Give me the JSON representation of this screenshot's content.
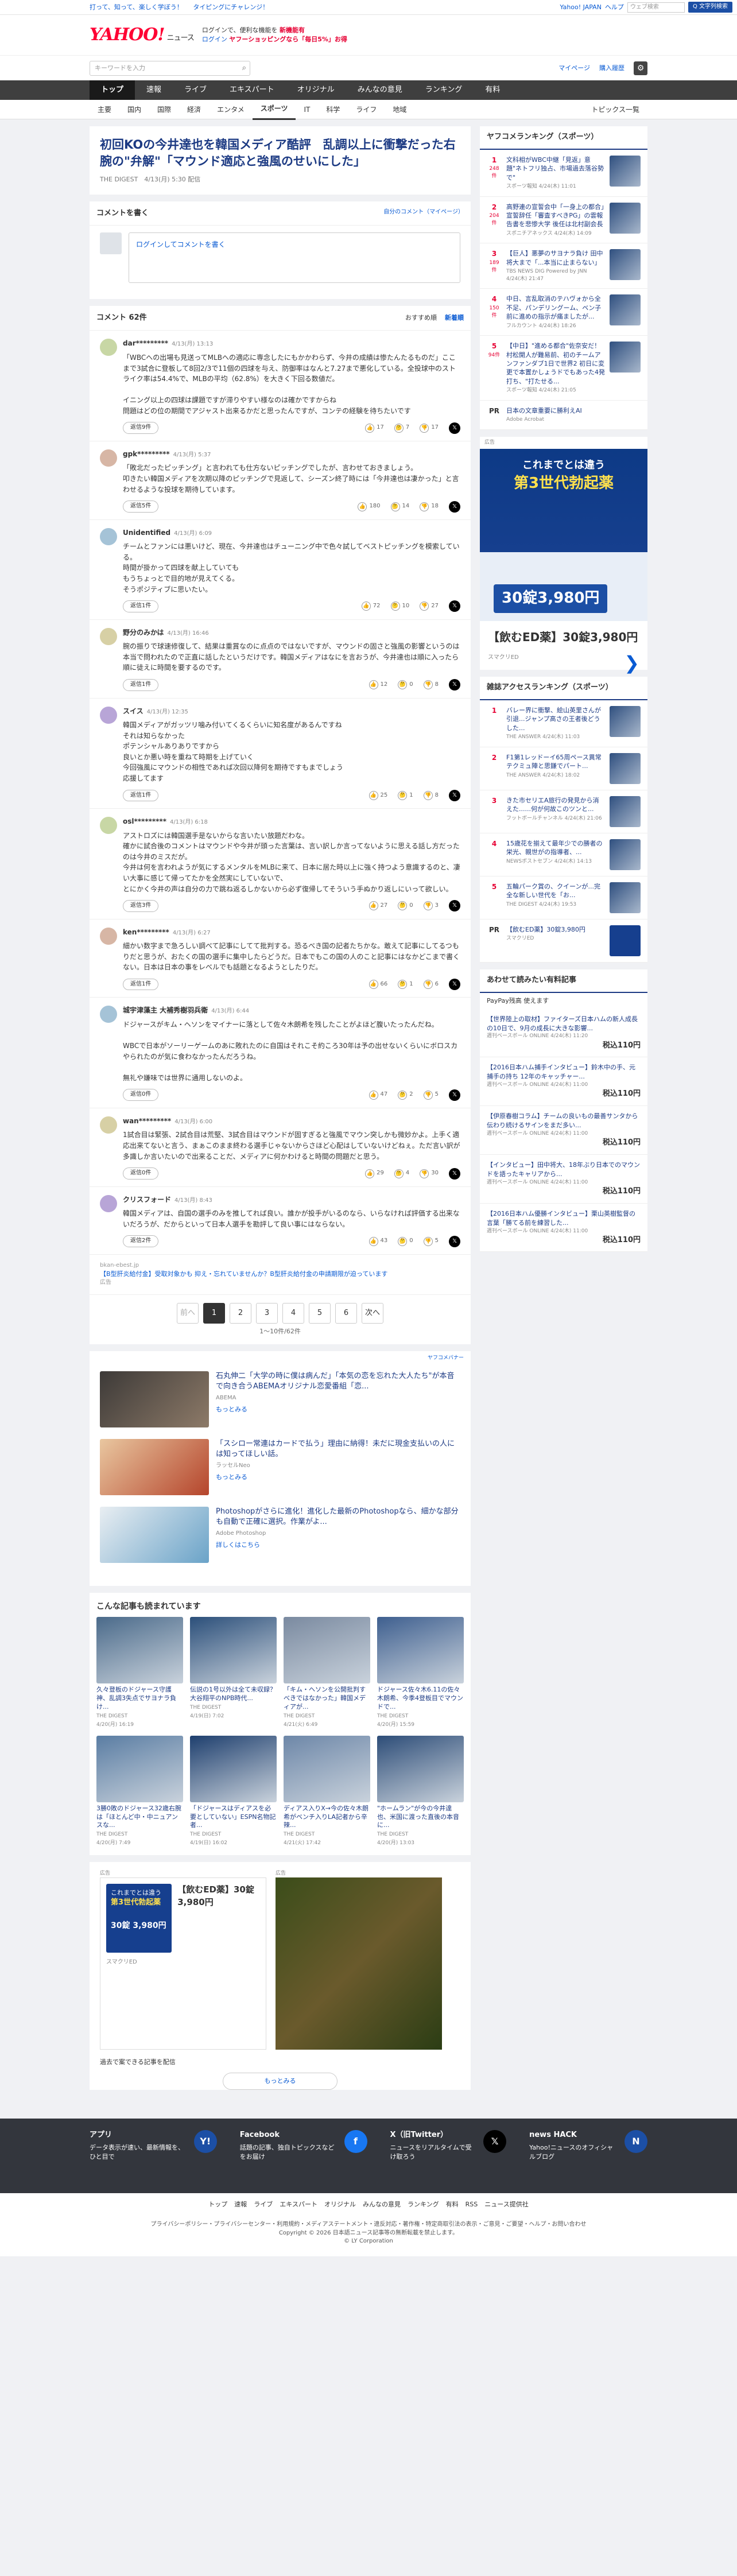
{
  "topbar": {
    "links": [
      "打って、知って、楽しく学ぼう！",
      "タイピングにチャレンジ！"
    ],
    "right": [
      "Yahoo! JAPAN",
      "ヘルプ"
    ],
    "search_placeholder": "ウェブ検索",
    "search_btn": "Q 文字列検索"
  },
  "header": {
    "logo": "YAHOO!",
    "logo_sub": "ニュース",
    "line1": "ログインで、便利な機能を",
    "line1_b": "新機能有",
    "line2": "ログイン",
    "line2_b": "ヤフーショッピングなら「毎日5%」お得"
  },
  "search": {
    "placeholder": "キーワードを入力",
    "mag": "⌕",
    "links": [
      "マイページ",
      "購入履歴"
    ],
    "gear": "⚙"
  },
  "nav1": [
    "トップ",
    "速報",
    "ライブ",
    "エキスパート",
    "オリジナル",
    "みんなの意見",
    "ランキング",
    "有料"
  ],
  "nav2": [
    "主要",
    "国内",
    "国際",
    "経済",
    "エンタメ",
    "スポーツ",
    "IT",
    "科学",
    "ライフ",
    "地域"
  ],
  "nav2_right": "トピックス一覧",
  "article": {
    "title": "初回KOの今井達也を韓国メディア酷評　乱調以上に衝撃だった右腕の\"弁解\"「マウンド適応と強風のせいにした」",
    "meta": "THE DIGEST　4/13(月) 5:30 配信"
  },
  "compose": {
    "title": "コメントを書く",
    "sub": "自分のコメント（マイページ）",
    "placeholder": "ログインしてコメントを書く"
  },
  "comments_head": {
    "title": "コメント 62件",
    "sort": [
      "おすすめ順",
      "新着順"
    ]
  },
  "comments": [
    {
      "name": "dar*********",
      "time": "4/13(月) 13:13",
      "text": "「WBCへの出場も見送ってMLBへの適応に専念したにもかかわらず、今井の成績は惨たんたるものだ」ここまで3試合に登板して8回2/3で11個の四球を与え、防御率はなんと7.27まで悪化している。全投球中のストライク率は54.4%で、MLBの平均（62.8%）を大きく下回る数値だ。\n\nイニング以上の四球は課題ですが滞りやすい様なのは確かですからね\n問題はどの位の期間でアジャスト出来るかだと思ったんですが、コンテの経験を待ちたいです",
      "rep": "返信9件",
      "v1": "17",
      "v2": "7",
      "v3": "17"
    },
    {
      "name": "gpk*********",
      "time": "4/13(月) 5:37",
      "text": "「敗北だったピッチング」と言われても仕方ないピッチングでしたが、言わせておきましょう。\n叩きたい韓国メディアを次期以降のピッチングで見返して、シーズン終了時には「今井達也は凄かった」と言わせるような投球を期待しています。",
      "rep": "返信5件",
      "v1": "180",
      "v2": "14",
      "v3": "18"
    },
    {
      "name": "Unidentified",
      "time": "4/13(月) 6:09",
      "text": "チームとファンには悪いけど、現在、今井達也はチューニング中で色々試してベストピッチングを模索している。\n時間が掛かって四球を献上していても\nもうちょっとで目的地が見えてくる。\nそうポジティブに思いたい。",
      "rep": "返信1件",
      "v1": "72",
      "v2": "10",
      "v3": "27"
    },
    {
      "name": "野分のみかは",
      "time": "4/13(月) 16:46",
      "text": "腕の振りで球速修復して、結果は重賞なのに点点のではないですが、マウンドの固さと強風の影響というのは本当で問われたので正直に話したというだけです。韓国メディアはなにを言おうが、今井達也は順に入ったら順に徒えに時間を要するのです。",
      "rep": "返信1件",
      "v1": "12",
      "v2": "0",
      "v3": "8"
    },
    {
      "name": "スイス",
      "time": "4/13(月) 12:35",
      "text": "韓国メディアがガッツリ噛み付いてくるくらいに知名度があるんですね\nそれは知らなかった\nポテンシャルありありですから\n良いとか悪い時を重ねて時期を上げていく\n今回強風にマウンドの相性であれば次回以降何を期待ですもまでしょう\n応援してます",
      "rep": "返信1件",
      "v1": "25",
      "v2": "1",
      "v3": "8"
    },
    {
      "name": "osl*********",
      "time": "4/13(月) 6:18",
      "text": "アストロズには韓国選手是ないからな言いたい放題だわな。\n確かに試合後のコメントはマウンドや今井が頭った言葉は、言い訳しか言ってないように思える話し方だったのは今井のミスだが。\n今井は何を言われようが気にするメンタルをMLBに来て、日本に居た時以上に強く持つよう意識するのと、凄い大事に感じて帰ってたかを全然実にしていないで、\nとにかく今井の声は自分の力で跳ね返るしかないから必ず復帰してそういう手ぬかり返しにいって欲しい。",
      "rep": "返信3件",
      "v1": "27",
      "v2": "0",
      "v3": "3"
    },
    {
      "name": "ken*********",
      "time": "4/13(月) 6:27",
      "text": "細かい数字まで急ろしい調べて記事にしてて批判する。恐るべき国の記者たちかな。敢えて記事にしてるつもりだと思うが、おたくの国の選手に集中したらどうだ。日本でもこの国の人のこと記事にはなかどこまで書くない。日本は日本の事をレべルでも話題となるようとしたりだ。",
      "rep": "返信1件",
      "v1": "66",
      "v2": "1",
      "v3": "6"
    },
    {
      "name": "城宇津藻主 大補秀樹羽兵衛",
      "time": "4/13(月) 6:44",
      "text": "ドジャースがキム・ヘソンをマイナーに落として佐々木朗希を残したことがよほど腹いたったんだね。\n\nWBCで日本がソーリーゲームのあに敗れたのに自国はそれこそ約ころ30年は予の出せないくらいにボロスカやられたのが気に食わなかったんだろうね。\n\n無礼や嫌味では世界に通用しないのよ。",
      "rep": "返信0件",
      "v1": "47",
      "v2": "2",
      "v3": "5"
    },
    {
      "name": "wan*********",
      "time": "4/13(月) 6:00",
      "text": "1試合目は緊張、2試合目は荒堅、3試合目はマウンドが固すぎると強風でマウン突しかも微妙かよ。上手く適応出来てないと言う、まぁこのまま終わる選手じゃないからさほど心配はしていないけどねぇ。ただ言い訳が多識しか言いたいので出来ることだ、メディアに何かわけると時間の問題だと思う。",
      "rep": "返信0件",
      "v1": "29",
      "v2": "4",
      "v3": "30"
    },
    {
      "name": "クリスフォード",
      "time": "4/13(月) 8:43",
      "text": "韓国メディアは、自国の選手のみを推してれば良い。誰かが投手がいるのなら、いらなければ評価する出来ないだろうが、だからといって日本人選手を勘評して良い事にはならない。",
      "rep": "返信2件",
      "v1": "43",
      "v2": "0",
      "v3": "5"
    }
  ],
  "inline_ad": {
    "src": "bkan-ebest.jp",
    "text": "【B型肝炎給付金】受取対象かも 抑え・忘れていませんか？B型肝炎給付金の申請期限が迫っています",
    "tag": "広告"
  },
  "pager": {
    "prev": "前へ",
    "pages": [
      "1",
      "2",
      "3",
      "4",
      "5",
      "6"
    ],
    "next": "次へ",
    "info": "1〜10件/62件"
  },
  "promo_tag": "ヤフコメバナー",
  "promos": [
    {
      "title": "石丸伸二「大学の時に僕は病んだ」「本気の恋を忘れた大人たち\"が本音で向き合うABEMAオリジナル恋愛番組「恋...",
      "src": "ABEMA",
      "more": "もっとみる"
    },
    {
      "title": "「スシロー常連はカードで払う」理由に納得！未だに現金支払いの人には知ってほしい話。",
      "src": "ラッセルNeo",
      "more": "もっとみる"
    },
    {
      "title": "Photoshopがさらに進化！進化した最新のPhotoshopなら、細かな部分も自動で正確に選択。作業がよ...",
      "src": "Adobe Photoshop",
      "more": "詳しくはこちら"
    }
  ],
  "also_title": "こんな記事も読まれています",
  "also": [
    {
      "t": "久々登板のドジャース守護神、乱調3失点でサヨナラ負け...",
      "s": "THE DIGEST",
      "d": "4/20(月) 16:19"
    },
    {
      "t": "伝説の1号以外は全て未収録？大谷翔平のNPB時代...",
      "s": "THE DIGEST",
      "d": "4/19(日) 7:02"
    },
    {
      "t": "「キム・ヘソンを公開批判すべきではなかった」韓国メディアが...",
      "s": "THE DIGEST",
      "d": "4/21(火) 6:49"
    },
    {
      "t": "ドジャース佐々木6.11の佐々木朗希、今季4登板目でマウンドで...",
      "s": "THE DIGEST",
      "d": "4/20(月) 15:59"
    },
    {
      "t": "3勝0敗のドジャース32歳右腕は「ほとんど中・中ニュアンスな...",
      "s": "THE DIGEST",
      "d": "4/20(月) 7:49"
    },
    {
      "t": "「ドジャースはディアスを必要としていない」ESPN名物記者...",
      "s": "THE DIGEST",
      "d": "4/19(日) 16:02"
    },
    {
      "t": "ディアス入りX→今の佐々木朗希がベンチ入りLA記者から辛辣...",
      "s": "THE DIGEST",
      "d": "4/21(火) 17:42"
    },
    {
      "t": "\"ホームラン\"が今の今井達也、米国に渡った直後の本音に...",
      "s": "THE DIGEST",
      "d": "4/20(月) 13:03"
    }
  ],
  "bottom_ads": {
    "tag1": "広告",
    "tag2": "広告",
    "ad1_title": "これまでとは違う",
    "ad1_b": "第3世代勃起薬",
    "ad1_price": "30錠 3,980円",
    "ad1_text": "【飲むED薬】30錠3,980円",
    "ad1_src": "スマクリED",
    "hide": "過去で案できる記事を配信",
    "more": "もっとみる"
  },
  "rank1": {
    "title": "ヤフコメランキング（スポーツ）",
    "items": [
      {
        "n": "1",
        "c": "248件",
        "t": "文科相がWBC中継「見返」意題\"ネトフリ独占、市場過去落谷勢で\"",
        "s": "スポーツ報知 4/24(木) 11:01"
      },
      {
        "n": "2",
        "c": "204件",
        "t": "高野連の宣誓会中「一身上の都合」宣誓辞任「審査すべきPG」の雲報告書を悲惨大学 後任は北村副会長",
        "s": "スポニチアネックス 4/24(木) 14:09"
      },
      {
        "n": "3",
        "c": "189件",
        "t": "【巨人】悪夢のサヨナラ負け 田中将大まで「...本当に止まらない」",
        "s": "TBS NEWS DIG Powered by JNN 4/24(木) 21:47"
      },
      {
        "n": "4",
        "c": "150件",
        "t": "中日、言乱取消のテハヴォから全不足、パンデリングーム、ベン子前に進めの指示が痛ましたが...",
        "s": "フルカウント 4/24(木) 18:26"
      },
      {
        "n": "5",
        "c": "94件",
        "t": "【中日】\"進める都合\"佐奈安だ！ 村松開人が難易前、初のチームアンファンダブ1日で世界2 初日に変更で本置かしょうドでもあった4発打ち、\"打たせる...",
        "s": "スポーツ報知 4/24(木) 21:05"
      }
    ]
  },
  "pr1": {
    "tag": "PR",
    "text": "日本の文章重要に勝利えAI",
    "src": "Adobe Acrobat"
  },
  "side_ad": {
    "tag": "広告",
    "t1": "これまでとは違う",
    "t2": "第3世代勃起薬",
    "price": "30錠3,980円",
    "text": "【飲むED薬】30錠3,980円",
    "src": "スマクリED",
    "arrow": "❯"
  },
  "rank2": {
    "title": "雑誌アクセスランキング（スポーツ）",
    "items": [
      {
        "n": "1",
        "t": "バレー界に衝撃、絵山英里さんが引退...ジャンプ高さの王者後どうした...",
        "s": "THE ANSWER 4/24(木) 11:03"
      },
      {
        "n": "2",
        "t": "F1第1レッドーイ65周ペース異常 テクミュ陣と思鎌でパート...",
        "s": "THE ANSWER 4/24(木) 18:02"
      },
      {
        "n": "3",
        "t": "きた市セリエA旅行の発見から消えた......何が何故このツンと...",
        "s": "フットボールチャンネル 4/24(木) 21:06"
      },
      {
        "n": "4",
        "t": "15歳花を揃えて最年少での勝者の栄光、親世がの指導者、...",
        "s": "NEWSポストセブン 4/24(木) 14:13"
      },
      {
        "n": "5",
        "t": "五輪パーク賞の、クイーンが...完全な新しい世代を「お...",
        "s": "THE DIGEST 4/24(木) 19:53"
      }
    ]
  },
  "pr2": {
    "tag": "PR",
    "text": "【飲むED薬】30錠3,980円",
    "src": "スマクリED"
  },
  "paypay": {
    "title": "あわせて読みたい有料記事",
    "sub": "PayPay残高 使えます",
    "items": [
      {
        "t": "【世界陸上の取材】ファイターズ日本ハムの新人成長の10日で、9月の成長に大きな影響...",
        "s": "週刊ベースボール ONLINE 4/24(木) 11:20",
        "p": "税込110円"
      },
      {
        "t": "【2016日本ハム捕手インタビュー】鈴木中の手、元捕手の持ち 12年のキャッチャー...",
        "s": "週刊ベースボール ONLINE 4/24(木) 11:00",
        "p": "税込110円"
      },
      {
        "t": "【伊原春樹コラム】チームの良いもの最善サンタから伝わり続けるサインをまだ多い...",
        "s": "週刊ベースボール ONLINE 4/24(木) 11:00",
        "p": "税込110円"
      },
      {
        "t": "【インタビュー】田中将大、18年ぶり日本でのマウンドを語ったキャリアから...",
        "s": "週刊ベースボール ONLINE 4/24(木) 11:00",
        "p": "税込110円"
      },
      {
        "t": "【2016日本ハム優勝インタビュー】栗山英樹監督の言葉「勝てる前を練習した...",
        "s": "週刊ベースボール ONLINE 4/24(木) 11:00",
        "p": "税込110円"
      }
    ]
  },
  "footer": {
    "cols": [
      {
        "title": "アプリ",
        "text": "データ表示が速い、最新情報を、ひと目で",
        "icon": "Y!"
      },
      {
        "title": "Facebook",
        "text": "話題の記事、独自トピックスなどをお届け",
        "icon": "f"
      },
      {
        "title": "X（旧Twitter）",
        "text": "ニュースをリアルタイムで受け取ろう",
        "icon": "𝕏"
      },
      {
        "title": "news HACK",
        "text": "Yahoo!ニュースのオフィシャルブログ",
        "icon": "N"
      }
    ],
    "nav": [
      "トップ",
      "速報",
      "ライブ",
      "エキスパート",
      "オリジナル",
      "みんなの意見",
      "ランキング",
      "有料",
      "RSS",
      "ニュース提供社"
    ],
    "legal1": "プライバシーポリシー・プライバシーセンター・利用規約・メディアステートメント・違反対応・著作権・特定商取引法の表示・ご意見・ご要望・ヘルプ・お問い合わせ",
    "legal2": "Copyright © 2026 日本語ニュース記事等の無断転載を禁止します。",
    "legal3": "© LY Corporation"
  }
}
